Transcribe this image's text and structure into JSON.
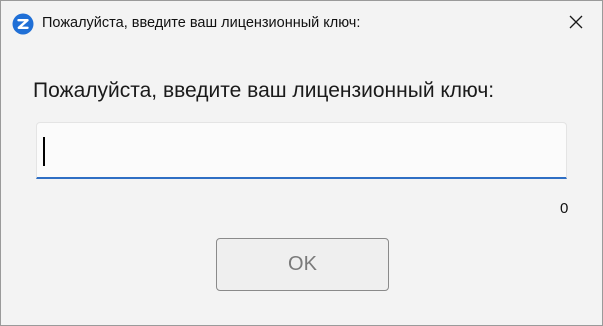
{
  "window": {
    "title": "Пожалуйста, введите ваш лицензионный ключ:",
    "app_icon": "app-logo-icon",
    "close_icon": "close-icon"
  },
  "dialog": {
    "prompt": "Пожалуйста, введите ваш лицензионный ключ:",
    "license_input": {
      "value": "",
      "placeholder": ""
    },
    "char_count": "0",
    "ok_label": "OK"
  },
  "colors": {
    "accent": "#2f6fc4",
    "logo": "#1f6fd6",
    "background": "#f3f3f3"
  }
}
